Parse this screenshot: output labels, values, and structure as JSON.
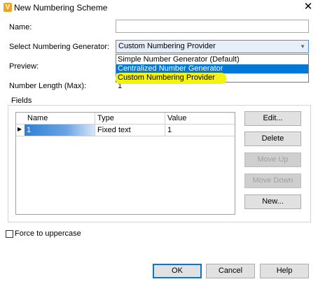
{
  "window": {
    "title": "New Numbering Scheme",
    "icon_glyph": "V",
    "close_glyph": "✕"
  },
  "form": {
    "name_label": "Name:",
    "name_value": "",
    "generator_label": "Select Numbering Generator:",
    "generator_selected": "Custom Numbering Provider",
    "generator_options": [
      "Simple Number Generator (Default)",
      "Centralized Number Generator",
      "Custom Numbering Provider"
    ],
    "preview_label": "Preview:",
    "length_label": "Number Length (Max):",
    "length_value": "1"
  },
  "fields": {
    "group_label": "Fields",
    "columns": [
      "Name",
      "Type",
      "Value"
    ],
    "rows": [
      {
        "name": "1",
        "type": "Fixed text",
        "value": "1"
      }
    ],
    "row_indicator": "▶"
  },
  "side_buttons": {
    "edit": "Edit...",
    "delete": "Delete",
    "move_up": "Move Up",
    "move_down": "Move Down",
    "new": "New..."
  },
  "force_uppercase_label": "Force to uppercase",
  "footer": {
    "ok": "OK",
    "cancel": "Cancel",
    "help": "Help"
  },
  "colors": {
    "accent": "#0078d7",
    "highlight": "#f4f210",
    "app_icon": "#f3a21f"
  }
}
